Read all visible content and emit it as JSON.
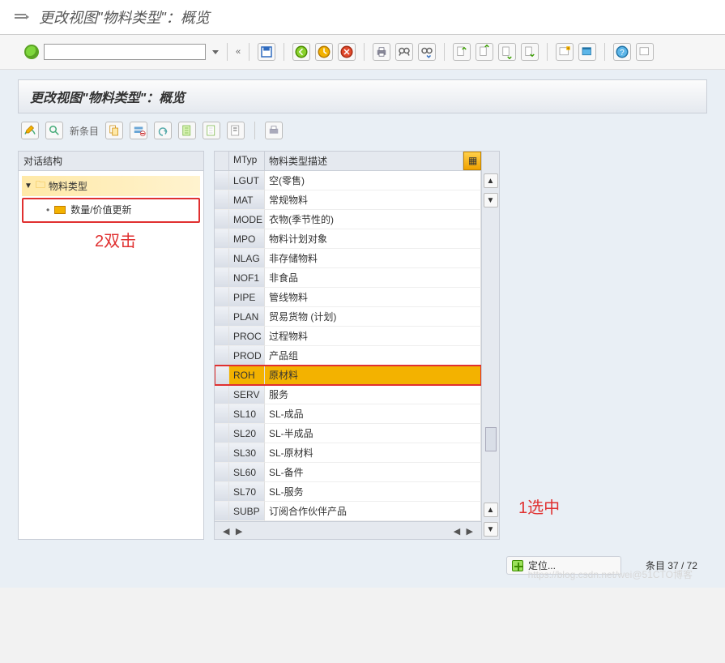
{
  "top": {
    "title": "更改视图\"物料类型\"：概览"
  },
  "panel": {
    "title": "更改视图\"物料类型\"：概览"
  },
  "actions": {
    "new_entries": "新条目"
  },
  "tree": {
    "header": "对话结构",
    "root": "物料类型",
    "child": "数量/价值更新"
  },
  "annotations": {
    "a1": "1选中",
    "a2": "2双击"
  },
  "table": {
    "headers": {
      "mtyp": "MTyp",
      "desc": "物料类型描述"
    },
    "selected_code": "ROH",
    "rows": [
      {
        "code": "LGUT",
        "desc": "空(零售)"
      },
      {
        "code": "MAT",
        "desc": "常规物料"
      },
      {
        "code": "MODE",
        "desc": "衣物(季节性的)"
      },
      {
        "code": "MPO",
        "desc": "物料计划对象"
      },
      {
        "code": "NLAG",
        "desc": "非存储物料"
      },
      {
        "code": "NOF1",
        "desc": "非食品"
      },
      {
        "code": "PIPE",
        "desc": "管线物料"
      },
      {
        "code": "PLAN",
        "desc": "贸易货物 (计划)"
      },
      {
        "code": "PROC",
        "desc": "过程物料"
      },
      {
        "code": "PROD",
        "desc": "产品组"
      },
      {
        "code": "ROH",
        "desc": "原材料"
      },
      {
        "code": "SERV",
        "desc": "服务"
      },
      {
        "code": "SL10",
        "desc": "SL-成品"
      },
      {
        "code": "SL20",
        "desc": "SL-半成品"
      },
      {
        "code": "SL30",
        "desc": "SL-原材料"
      },
      {
        "code": "SL60",
        "desc": "SL-备件"
      },
      {
        "code": "SL70",
        "desc": "SL-服务"
      },
      {
        "code": "SUBP",
        "desc": "订阅合作伙伴产品"
      }
    ]
  },
  "footer": {
    "position_btn": "定位...",
    "count": "条目 37 / 72"
  },
  "watermark": "https://blog.csdn.net/wei@51CTO博客"
}
